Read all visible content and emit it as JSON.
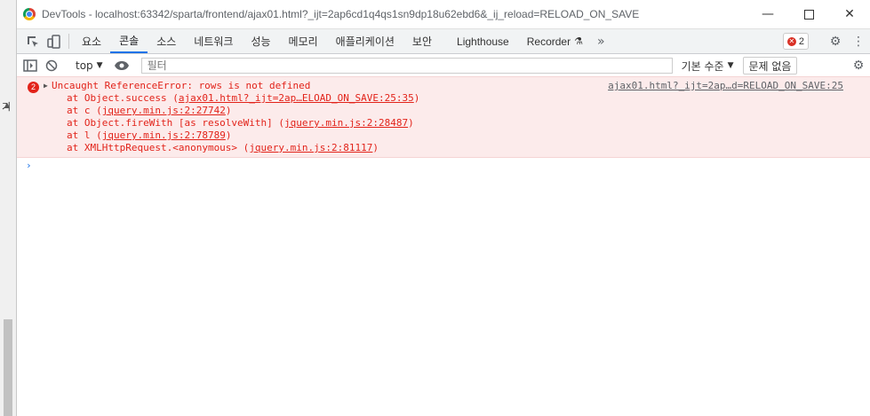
{
  "background": {
    "fragment": "기"
  },
  "window": {
    "title": "DevTools - localhost:63342/sparta/frontend/ajax01.html?_ijt=2ap6cd1q4qs1sn9dp18u62ebd6&_ij_reload=RELOAD_ON_SAVE",
    "minimize": "—",
    "close": "✕"
  },
  "tabs": [
    {
      "label": "요소"
    },
    {
      "label": "콘솔"
    },
    {
      "label": "소스"
    },
    {
      "label": "네트워크"
    },
    {
      "label": "성능"
    },
    {
      "label": "메모리"
    },
    {
      "label": "애플리케이션"
    },
    {
      "label": "보안"
    },
    {
      "label": "Lighthouse"
    },
    {
      "label": "Recorder"
    }
  ],
  "more_tabs": "»",
  "error_badge": {
    "count": "2"
  },
  "filterbar": {
    "context": "top",
    "filter_placeholder": "필터",
    "levels": "기본 수준",
    "issues": "문제 없음"
  },
  "console": {
    "error_count": "2",
    "message": "Uncaught ReferenceError: rows is not defined",
    "source": "ajax01.html?_ijt=2ap…d=RELOAD_ON_SAVE:25",
    "stack": [
      {
        "prefix": "at Object.success (",
        "link": "ajax01.html?_ijt=2ap…ELOAD_ON_SAVE:25:35",
        "suffix": ")"
      },
      {
        "prefix": "at c (",
        "link": "jquery.min.js:2:27742",
        "suffix": ")"
      },
      {
        "prefix": "at Object.fireWith [as resolveWith] (",
        "link": "jquery.min.js:2:28487",
        "suffix": ")"
      },
      {
        "prefix": "at l (",
        "link": "jquery.min.js:2:78789",
        "suffix": ")"
      },
      {
        "prefix": "at XMLHttpRequest.<anonymous> (",
        "link": "jquery.min.js:2:81117",
        "suffix": ")"
      }
    ],
    "prompt": "›"
  },
  "colors": {
    "accent": "#1a73e8",
    "error": "#e2231a",
    "error_bg": "#fcebeb"
  }
}
